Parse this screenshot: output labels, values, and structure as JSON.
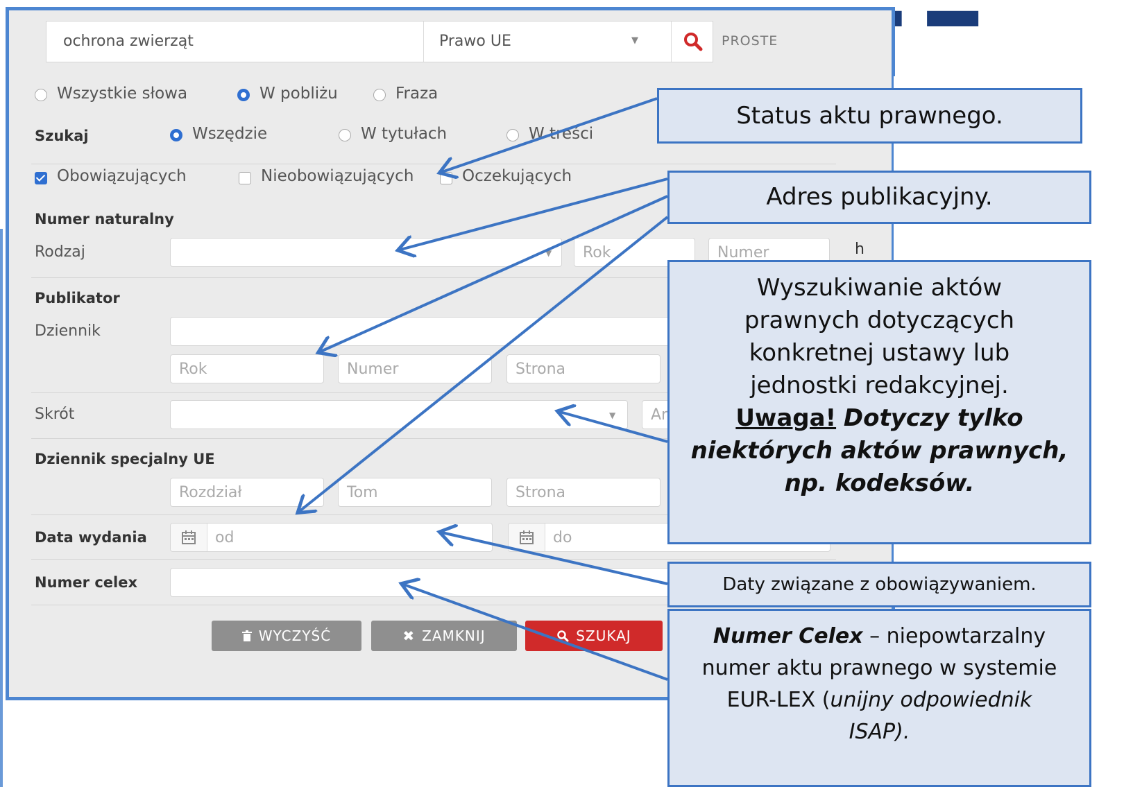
{
  "search": {
    "query": "ochrona zwierząt",
    "category": "Prawo UE",
    "mode_label": "PROSTE"
  },
  "match_options": [
    "Wszystkie słowa",
    "W pobliżu",
    "Fraza"
  ],
  "match_selected": "W pobliżu",
  "scope": {
    "label": "Szukaj",
    "options": [
      "Wszędzie",
      "W tytułach",
      "W treści"
    ],
    "selected": "Wszędzie"
  },
  "status": {
    "options": [
      "Obowiązujących",
      "Nieobowiązujących",
      "Oczekujących"
    ],
    "checked": [
      "Obowiązujących"
    ]
  },
  "numer_naturalny": {
    "header": "Numer naturalny",
    "rodzaj_label": "Rodzaj",
    "rok_ph": "Rok",
    "numer_ph": "Numer",
    "clipped_char": "h"
  },
  "publikator": {
    "header": "Publikator",
    "dziennik_label": "Dziennik",
    "rok_ph": "Rok",
    "numer_ph": "Numer",
    "strona_ph": "Strona"
  },
  "skrot": {
    "label": "Skrót",
    "art_ph": "Ar"
  },
  "dziennik_specjalny": {
    "header": "Dziennik specjalny UE",
    "rozdzial_ph": "Rozdział",
    "tom_ph": "Tom",
    "strona_ph": "Strona"
  },
  "data_wydania": {
    "label": "Data wydania",
    "od_ph": "od",
    "do_ph": "do"
  },
  "celex": {
    "label": "Numer celex"
  },
  "buttons": {
    "clear": "WYCZYŚĆ",
    "close": "ZAMKNIJ",
    "search": "SZUKAJ"
  },
  "callouts": {
    "status": "Status aktu prawnego.",
    "address": "Adres publikacyjny.",
    "search_info_lines": [
      "Wyszukiwanie aktów",
      "prawnych dotyczących",
      "konkretnej ustawy lub",
      "jednostki redakcyjnej."
    ],
    "warning_label": "Uwaga!",
    "warning_text_1": "Dotyczy tylko",
    "warning_text_2": "niektórych aktów prawnych,",
    "warning_text_3": "np. kodeksów.",
    "dates": "Daty związane z obowiązywaniem.",
    "celex_title": "Numer Celex",
    "celex_dash": " – niepowtarzalny",
    "celex_line2": "numer aktu prawnego w systemie",
    "celex_line3_a": "EUR-LEX (",
    "celex_line3_b": "unijny odpowiednik",
    "celex_line4": "ISAP)."
  },
  "colors": {
    "accent": "#2f6fd1",
    "callout_border": "#3c74c3",
    "callout_fill": "#dde5f2",
    "search_red": "#d02a2a"
  }
}
